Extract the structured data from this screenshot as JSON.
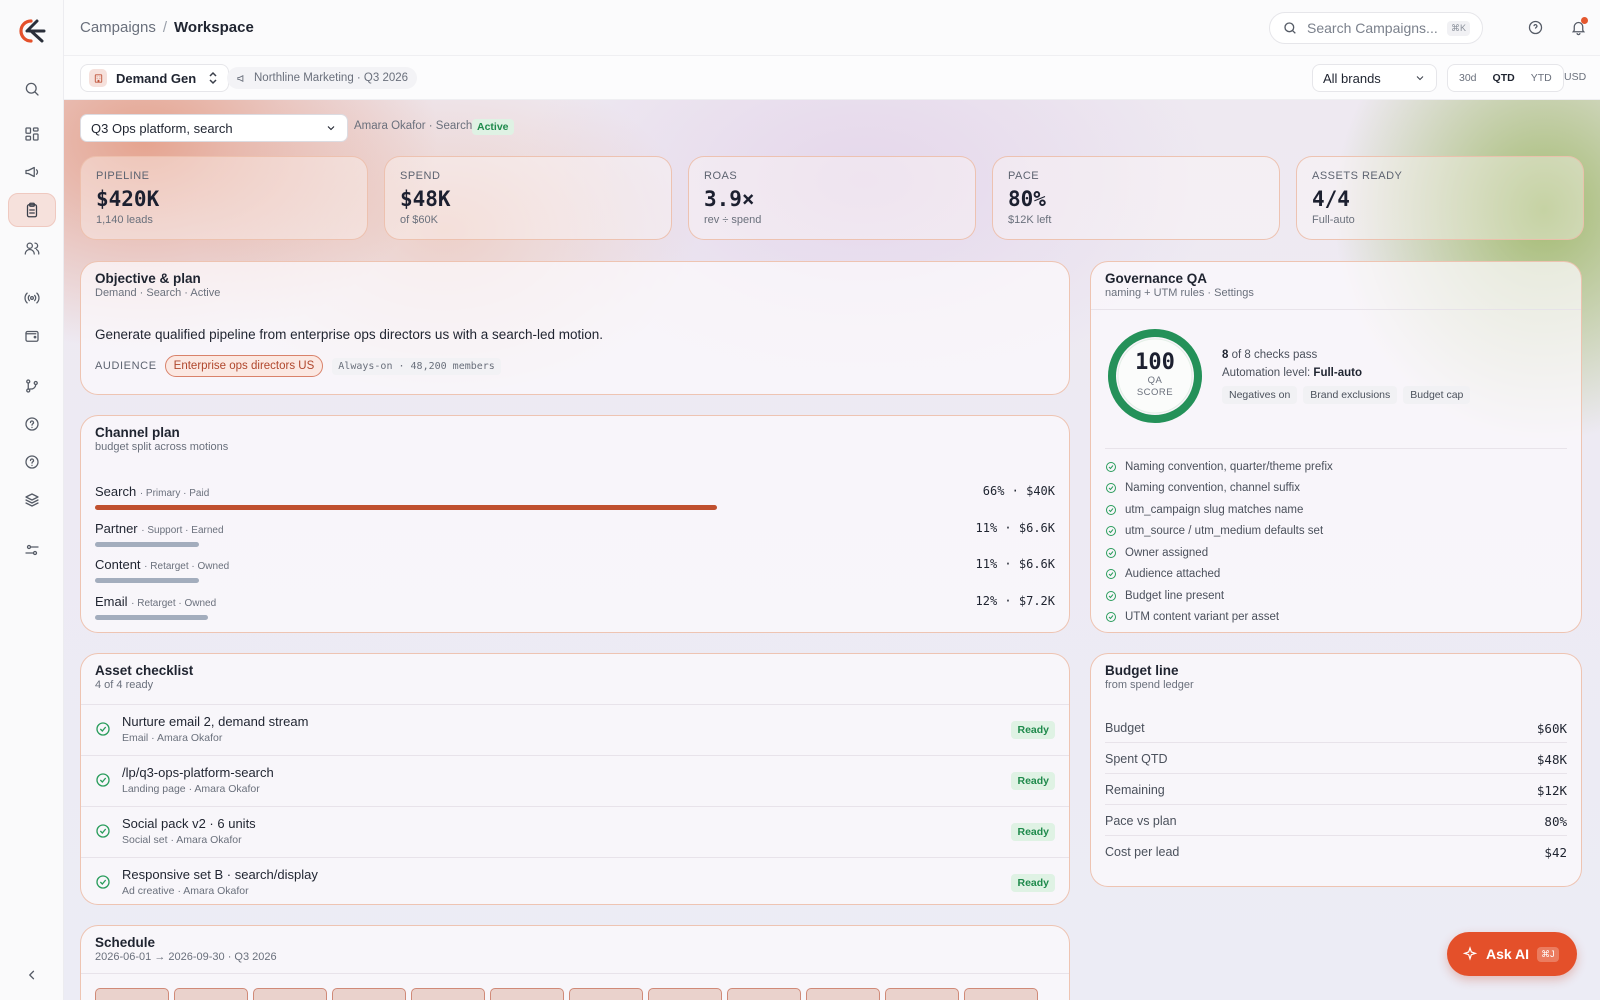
{
  "header": {
    "crumb_parent": "Campaigns",
    "crumb_sep": "/",
    "crumb_current": "Workspace",
    "search_placeholder": "Search Campaigns...",
    "search_kbd": "⌘K"
  },
  "subbar": {
    "workspace": "Demand Gen",
    "tagline": "Northline Marketing · Q3 2026",
    "brand_filter": "All brands",
    "ranges": [
      "30d",
      "QTD",
      "YTD"
    ],
    "active_range": "QTD",
    "currency": "USD"
  },
  "campaign": {
    "selected": "Q3 Ops platform, search",
    "owner": "Amara Okafor · Search",
    "status": "Active"
  },
  "kpis": [
    {
      "label": "PIPELINE",
      "value": "$420K",
      "sub": "1,140 leads"
    },
    {
      "label": "SPEND",
      "value": "$48K",
      "sub": "of $60K"
    },
    {
      "label": "ROAS",
      "value": "3.9×",
      "sub": "rev ÷ spend"
    },
    {
      "label": "PACE",
      "value": "80%",
      "sub": "$12K left"
    },
    {
      "label": "ASSETS READY",
      "value": "4/4",
      "sub": "Full-auto"
    }
  ],
  "objective": {
    "title": "Objective & plan",
    "subtitle": "Demand · Search · Active",
    "text": "Generate qualified pipeline from enterprise ops directors us with a search-led motion.",
    "audience_label": "AUDIENCE",
    "audience": "Enterprise ops directors US",
    "audience_meta": "Always-on · 48,200 members"
  },
  "channel": {
    "title": "Channel plan",
    "subtitle": "budget split across motions",
    "rows": [
      {
        "name": "Search",
        "meta": "· Primary · Paid",
        "pct": 66,
        "summary": "66% · $40K",
        "primary": true
      },
      {
        "name": "Partner",
        "meta": "· Support · Earned",
        "pct": 11,
        "summary": "11% · $6.6K",
        "primary": false
      },
      {
        "name": "Content",
        "meta": "· Retarget · Owned",
        "pct": 11,
        "summary": "11% · $6.6K",
        "primary": false
      },
      {
        "name": "Email",
        "meta": "· Retarget · Owned",
        "pct": 12,
        "summary": "12% · $7.2K",
        "primary": false
      }
    ]
  },
  "assets": {
    "title": "Asset checklist",
    "subtitle": "4 of 4 ready",
    "items": [
      {
        "name": "Nurture email 2, demand stream",
        "meta": "Email · Amara Okafor",
        "status": "Ready"
      },
      {
        "name": "/lp/q3-ops-platform-search",
        "meta": "Landing page · Amara Okafor",
        "status": "Ready"
      },
      {
        "name": "Social pack v2 · 6 units",
        "meta": "Social set · Amara Okafor",
        "status": "Ready"
      },
      {
        "name": "Responsive set B · search/display",
        "meta": "Ad creative · Amara Okafor",
        "status": "Ready"
      }
    ]
  },
  "schedule": {
    "title": "Schedule",
    "subtitle": "2026-06-01 → 2026-09-30 · Q3 2026"
  },
  "qa": {
    "title": "Governance QA",
    "subtitle": "naming + UTM rules · Settings",
    "score": "100",
    "score_label_1": "QA",
    "score_label_2": "SCORE",
    "score_fraction": 1.0,
    "checks_pass_count": "8",
    "checks_pass_text": "of 8 checks pass",
    "automation_label": "Automation level:",
    "automation_value": "Full-auto",
    "tags": [
      "Negatives on",
      "Brand exclusions",
      "Budget cap"
    ],
    "checks": [
      "Naming convention, quarter/theme prefix",
      "Naming convention, channel suffix",
      "utm_campaign slug matches name",
      "utm_source / utm_medium defaults set",
      "Owner assigned",
      "Audience attached",
      "Budget line present",
      "UTM content variant per asset"
    ]
  },
  "budget": {
    "title": "Budget line",
    "subtitle": "from spend ledger",
    "rows": [
      {
        "label": "Budget",
        "value": "$60K"
      },
      {
        "label": "Spent QTD",
        "value": "$48K"
      },
      {
        "label": "Remaining",
        "value": "$12K"
      },
      {
        "label": "Pace vs plan",
        "value": "80%"
      },
      {
        "label": "Cost per lead",
        "value": "$42"
      }
    ]
  },
  "ask_ai": {
    "label": "Ask AI",
    "kbd": "⌘J"
  },
  "colors": {
    "accent": "#e4502a",
    "primary_bar": "#c0502f",
    "success": "#2a9d5c"
  }
}
